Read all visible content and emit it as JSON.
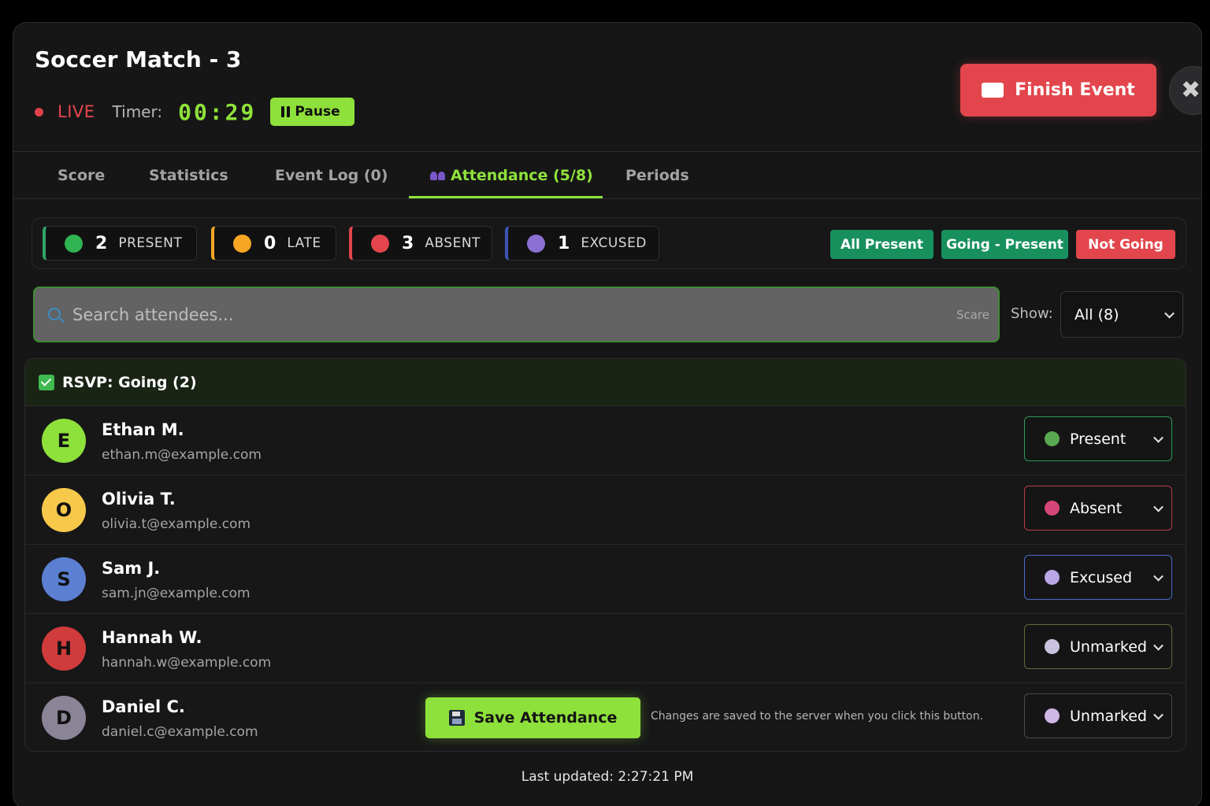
{
  "header": {
    "title": "Soccer Match - 3",
    "live_label": "LIVE",
    "timer_label": "Timer:",
    "timer_value": "00:29",
    "pause_label": "Pause",
    "finish_label": "Finish Event",
    "close_glyph": "✖"
  },
  "tabs": [
    {
      "label": "Score"
    },
    {
      "label": "Statistics"
    },
    {
      "label": "Event Log (0)"
    },
    {
      "label": "Attendance (5/8)",
      "active": true
    },
    {
      "label": "Periods"
    }
  ],
  "stats": [
    {
      "count": "2",
      "label": "PRESENT",
      "color": "#2fb451"
    },
    {
      "count": "0",
      "label": "LATE",
      "color": "#f5a623"
    },
    {
      "count": "3",
      "label": "ABSENT",
      "color": "#e2464c"
    },
    {
      "count": "1",
      "label": "EXCUSED",
      "color": "#8b6fd1"
    }
  ],
  "quick_actions": {
    "all_present": "All Present",
    "going_present": "Going - Present",
    "not_going": "Not Going"
  },
  "search": {
    "placeholder": "Search attendees...",
    "hint": "Scare"
  },
  "filter": {
    "label": "Show:",
    "value": "All (8)"
  },
  "group": {
    "title": "RSVP: Going (2)"
  },
  "attendees": [
    {
      "initial": "E",
      "name": "Ethan M.",
      "email": "ethan.m@example.com",
      "status": "Present",
      "avatar_color": "#8ee03b",
      "status_color": "#5aa84f",
      "border_color": "#2f9a5a"
    },
    {
      "initial": "O",
      "name": "Olivia T.",
      "email": "olivia.t@example.com",
      "status": "Absent",
      "avatar_color": "#f7c94a",
      "status_color": "#d6457a",
      "border_color": "#b93a45"
    },
    {
      "initial": "S",
      "name": "Sam J.",
      "email": "sam.jn@example.com",
      "status": "Excused",
      "avatar_color": "#5b7fd1",
      "status_color": "#b9a7e6",
      "border_color": "#4c6bc6"
    },
    {
      "initial": "H",
      "name": "Hannah W.",
      "email": "hannah.w@example.com",
      "status": "Unmarked",
      "avatar_color": "#d03b3b",
      "status_color": "#c9c3e0",
      "border_color": "#5e6b3a"
    },
    {
      "initial": "D",
      "name": "Daniel C.",
      "email": "daniel.c@example.com",
      "status": "Unmarked",
      "avatar_color": "#8a8496",
      "status_color": "#cfb8e6",
      "border_color": "#4a4a50"
    }
  ],
  "save": {
    "label": "Save Attendance",
    "note": "Changes are saved to the server when you click this button."
  },
  "footer": {
    "last_updated": "Last updated: 2:27:21 PM"
  }
}
